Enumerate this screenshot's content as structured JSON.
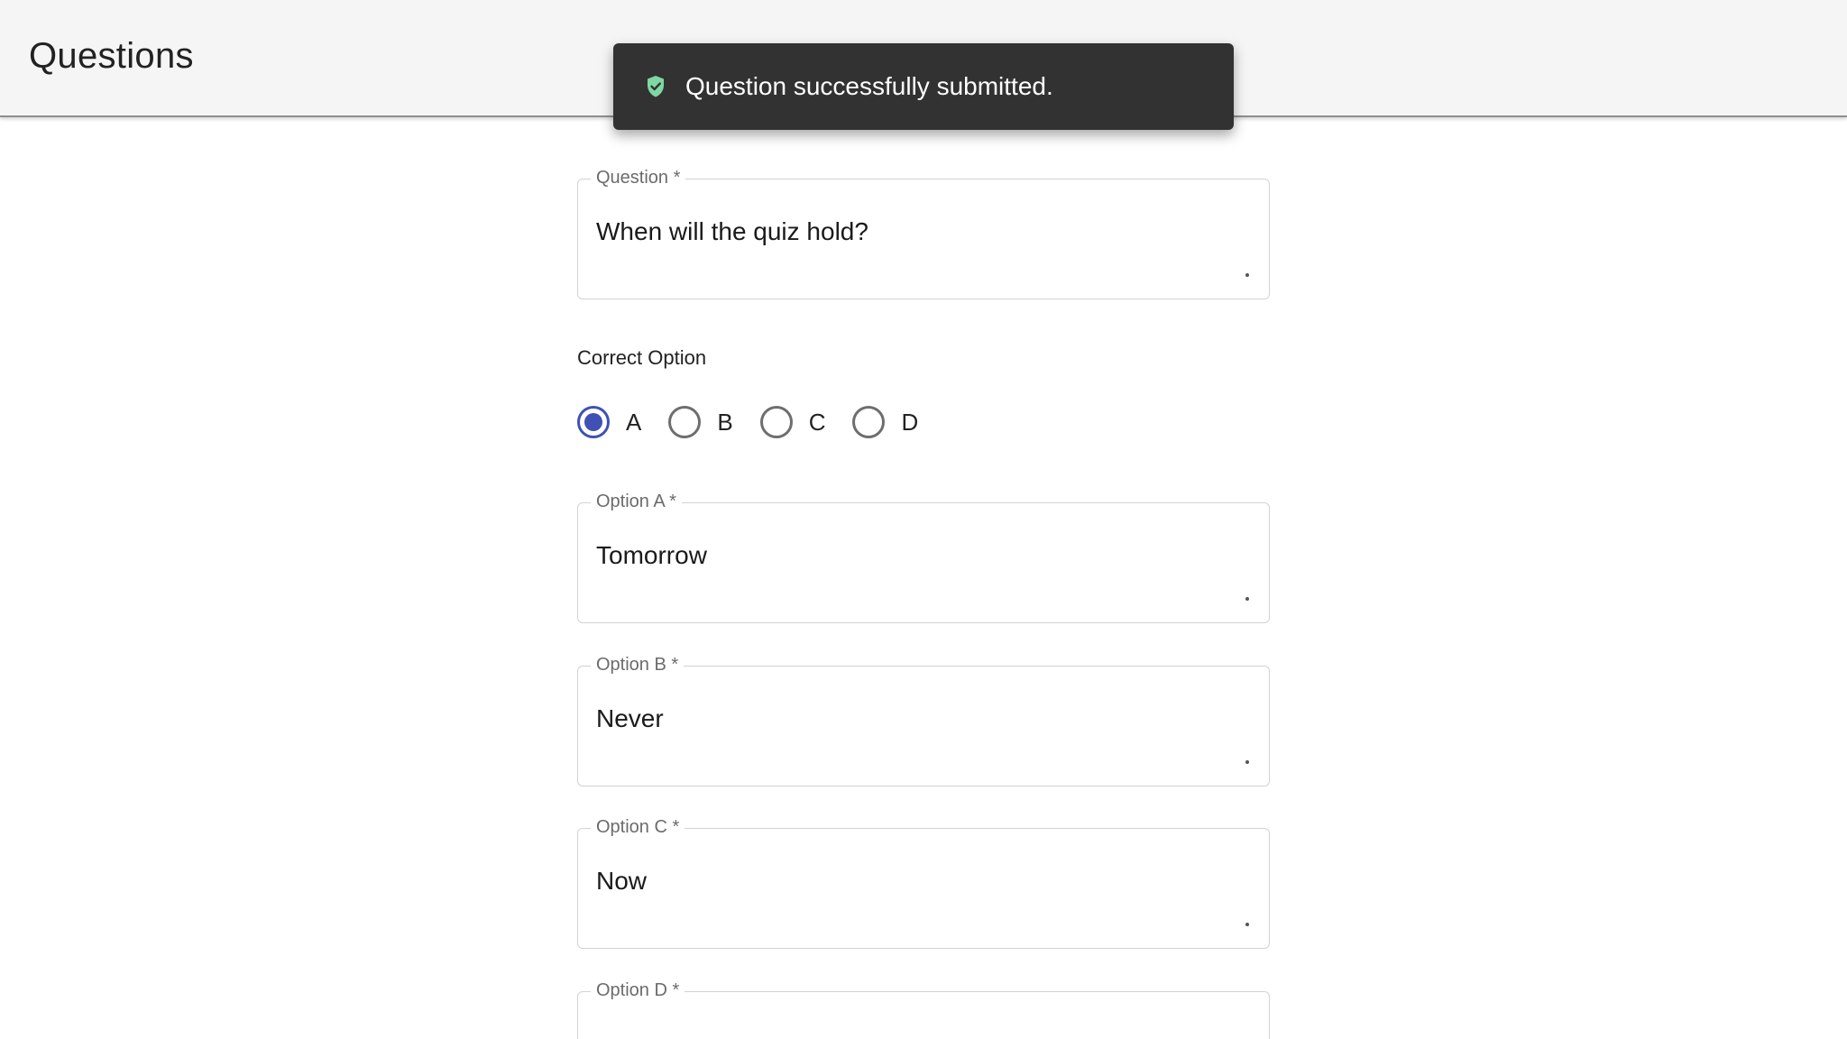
{
  "header": {
    "title": "Questions"
  },
  "toast": {
    "message": "Question successfully submitted.",
    "icon": "shield-check-icon",
    "icon_color": "#7fd7a3"
  },
  "form": {
    "question": {
      "label": "Question *",
      "value": "When will the quiz hold?"
    },
    "correct_option": {
      "label": "Correct Option",
      "selected": "A",
      "options": [
        "A",
        "B",
        "C",
        "D"
      ]
    },
    "option_a": {
      "label": "Option A *",
      "value": "Tomorrow"
    },
    "option_b": {
      "label": "Option B *",
      "value": "Never"
    },
    "option_c": {
      "label": "Option C *",
      "value": "Now"
    },
    "option_d": {
      "label": "Option D *",
      "value": ""
    }
  },
  "colors": {
    "accent": "#3f51b5",
    "toast_bg": "#323232",
    "app_bar_bg": "#f5f5f5"
  }
}
